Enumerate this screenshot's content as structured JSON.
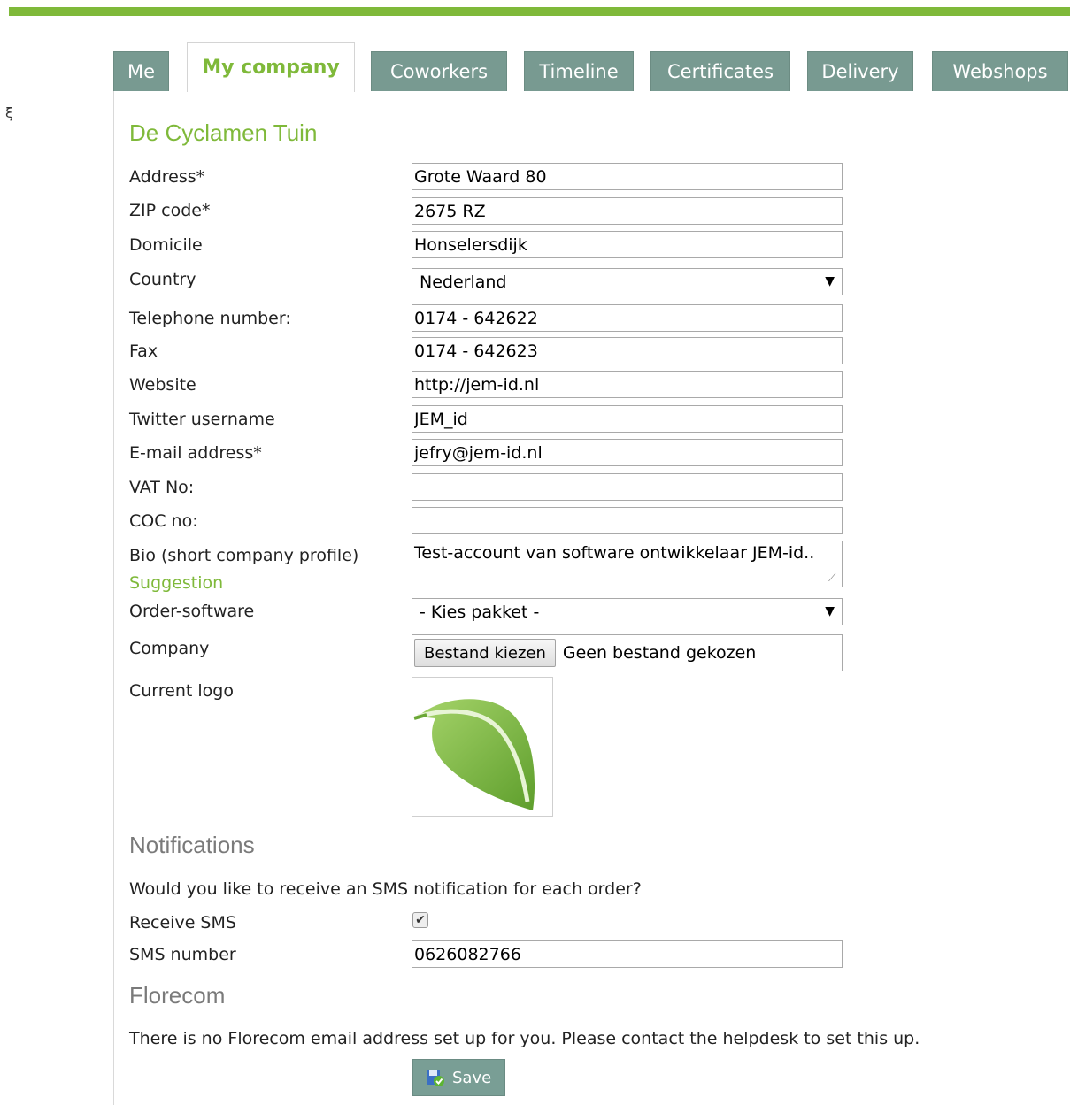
{
  "colors": {
    "accent": "#7fb93a",
    "tab_bg": "#789a91",
    "heading_gray": "#7a7a7a"
  },
  "side_mark": "ξ",
  "tabs": [
    {
      "label": "Me"
    },
    {
      "label": "My company"
    },
    {
      "label": "Coworkers"
    },
    {
      "label": "Timeline"
    },
    {
      "label": "Certificates"
    },
    {
      "label": "Delivery"
    },
    {
      "label": "Webshops"
    }
  ],
  "company": {
    "name": "De Cyclamen Tuin",
    "address": {
      "label": "Address*",
      "value": "Grote Waard 80"
    },
    "zip": {
      "label": "ZIP code*",
      "value": "2675 RZ"
    },
    "domicile": {
      "label": "Domicile",
      "value": "Honselersdijk"
    },
    "country": {
      "label": "Country",
      "value": "Nederland"
    },
    "telephone": {
      "label": "Telephone number:",
      "value": "0174 - 642622"
    },
    "fax": {
      "label": "Fax",
      "value": "0174 - 642623"
    },
    "website": {
      "label": "Website",
      "value": "http://jem-id.nl"
    },
    "twitter": {
      "label": "Twitter username",
      "value": "JEM_id"
    },
    "email": {
      "label": "E-mail address*",
      "value": "jefry@jem-id.nl"
    },
    "vat": {
      "label": "VAT No:",
      "value": ""
    },
    "coc": {
      "label": "COC no:",
      "value": ""
    },
    "bio": {
      "label": "Bio (short company profile)",
      "value": "Test-account van software ontwikkelaar JEM-id..",
      "suggestion": "Suggestion"
    },
    "order_software": {
      "label": "Order-software",
      "value": "- Kies pakket -"
    },
    "logo_upload": {
      "label": "Company",
      "button": "Bestand kiezen",
      "status": "Geen bestand gekozen"
    },
    "current_logo": {
      "label": "Current logo",
      "icon": "leaf-logo"
    }
  },
  "notifications": {
    "heading": "Notifications",
    "question": "Would you like to receive an SMS notification for each order?",
    "receive_sms": {
      "label": "Receive SMS",
      "checked": true,
      "mark": "✔"
    },
    "sms_number": {
      "label": "SMS number",
      "value": "0626082766"
    }
  },
  "florecom": {
    "heading": "Florecom",
    "message": "There is no Florecom email address set up for you. Please contact the helpdesk to set this up."
  },
  "save": {
    "label": "Save",
    "icon": "save-shield-icon"
  },
  "select_caret": "▼",
  "resize_grip": "⟋"
}
